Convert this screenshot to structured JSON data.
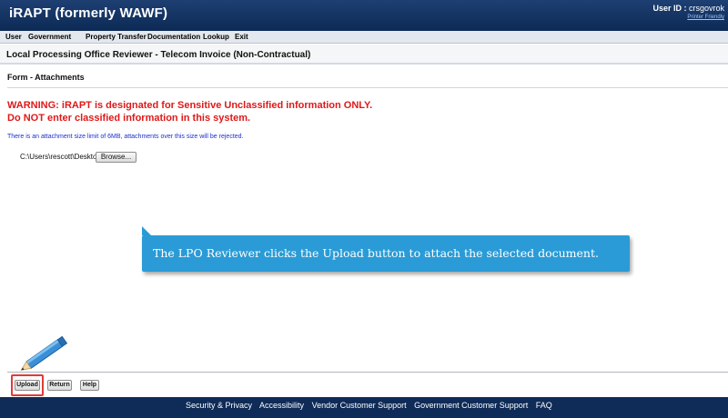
{
  "header": {
    "app_title": "iRAPT (formerly WAWF)",
    "user_label": "User ID :",
    "user_value": "crsgovrok",
    "printer_friendly": "Printer Friendly"
  },
  "menu": [
    "User",
    "Government",
    "Property Transfer",
    "Documentation",
    "Lookup",
    "Exit"
  ],
  "page": {
    "title": "Local Processing Office Reviewer - Telecom Invoice (Non-Contractual)",
    "section": "Form - Attachments",
    "warning_1": "WARNING: iRAPT is designated for Sensitive Unclassified information ONLY.",
    "warning_2": "Do NOT enter classified information in this system.",
    "size_note": "There is an attachment size limit of 6MB, attachments over this size will be rejected.",
    "file_path": "C:\\Users\\rescott\\Desktop",
    "browse_label": "Browse..."
  },
  "callout": {
    "text": "The LPO Reviewer clicks the Upload button to attach the selected document."
  },
  "buttons": {
    "upload": "Upload",
    "return": "Return",
    "help": "Help"
  },
  "footer": [
    "Security & Privacy",
    "Accessibility",
    "Vendor Customer Support",
    "Government Customer Support",
    "FAQ"
  ],
  "colors": {
    "header_bg": "#0d2a55",
    "warning": "#e01818",
    "note": "#1a2fd0",
    "callout": "#2a9bd6",
    "highlight": "#e23a3a"
  },
  "icons": {
    "pointer": "pencil-icon"
  }
}
